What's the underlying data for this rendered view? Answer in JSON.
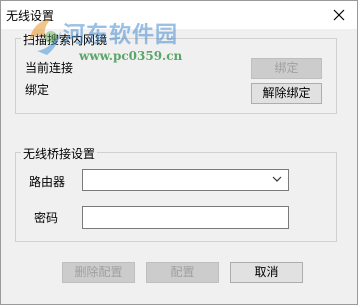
{
  "window": {
    "title": "无线设置"
  },
  "watermark": {
    "brand": "河东软件园",
    "url": "www.pc0359.cn"
  },
  "scan_group": {
    "legend": "扫描搜索内网镜",
    "current_connection_label": "当前连接",
    "bound_label": "绑定",
    "bind_button": "绑定",
    "unbind_button": "解除绑定"
  },
  "bridge_group": {
    "legend": "无线桥接设置",
    "router_label": "路由器",
    "router_value": "",
    "password_label": "密码",
    "password_value": ""
  },
  "footer": {
    "delete_config_button": "删除配置",
    "config_button": "配置",
    "cancel_button": "取消"
  }
}
